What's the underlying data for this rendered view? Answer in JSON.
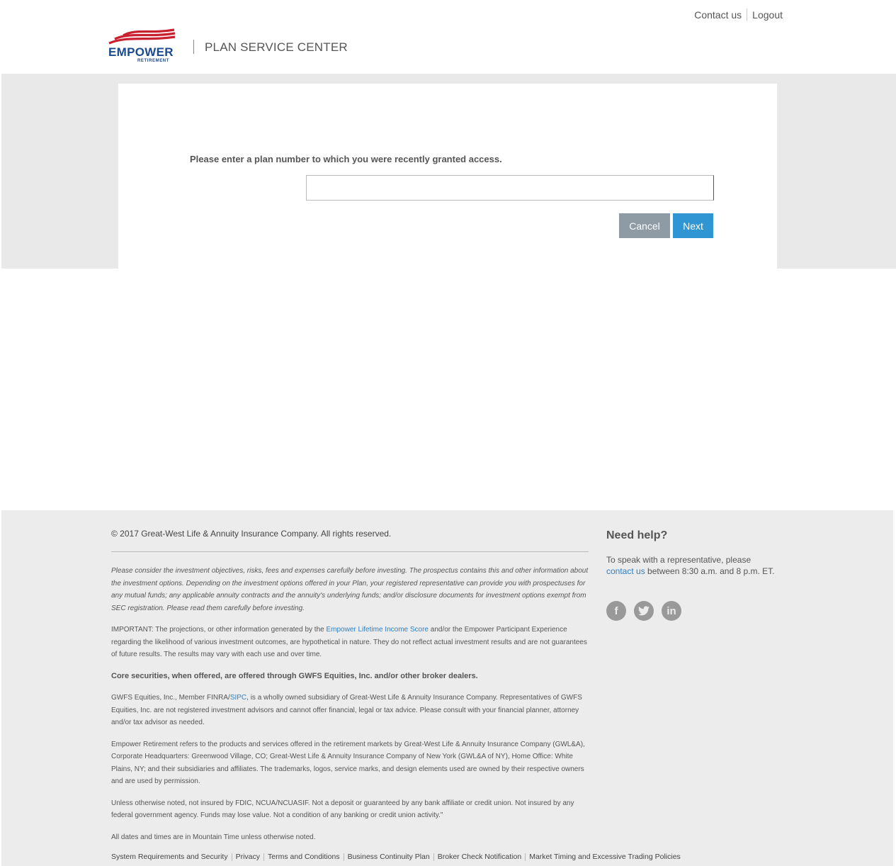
{
  "header": {
    "contact_label": "Contact us",
    "logout_label": "Logout",
    "logo_text": "EMPOWER",
    "logo_subtext": "RETIREMENT",
    "app_title": "PLAN SERVICE CENTER"
  },
  "form": {
    "prompt": "Please enter a plan number to which you were recently granted access.",
    "plan_number_value": "",
    "cancel_label": "Cancel",
    "next_label": "Next"
  },
  "footer": {
    "copyright": "© 2017 Great-West Life & Annuity Insurance Company. All rights reserved.",
    "prospectus": "Please consider the investment objectives, risks, fees and expenses carefully before investing. The prospectus contains this and other information about the investment options. Depending on the investment options offered in your Plan, your registered representative can provide you with prospectuses for any mutual funds; any applicable annuity contracts and the annuity's underlying funds; and/or disclosure documents for investment options exempt from SEC registration. Please read them carefully before investing.",
    "important_pre": "IMPORTANT: The projections, or other information generated by the ",
    "important_link": "Empower Lifetime Income Score",
    "important_post": " and/or the Empower Participant Experience regarding the likelihood of various investment outcomes, are hypothetical in nature. They do not reflect actual investment results and are not guarantees of future results. The results may vary with each use and over time.",
    "core_securities": "Core securities, when offered, are offered through GWFS Equities, Inc. and/or other broker dealers.",
    "gwfs_pre": "GWFS Equities, Inc., Member FINRA/",
    "gwfs_link": "SIPC",
    "gwfs_post": ", is a wholly owned subsidiary of Great-West Life & Annuity Insurance Company. Representatives of GWFS Equities, Inc. are not registered investment advisors and cannot offer financial, legal or tax advice. Please consult with your financial planner, attorney and/or tax advisor as needed.",
    "empower_refers": "Empower Retirement refers to the products and services offered in the retirement markets by Great-West Life & Annuity Insurance Company (GWL&A), Corporate Headquarters: Greenwood Village, CO; Great-West Life & Annuity Insurance Company of New York (GWL&A of NY), Home Office: White Plains, NY; and their subsidiaries and affiliates. The trademarks, logos, service marks, and design elements used are owned by their respective owners and are used by permission.",
    "not_insured": "Unless otherwise noted, not insured by FDIC, NCUA/NCUASIF. Not a deposit or guaranteed by any bank affiliate or credit union. Not insured by any federal government agency. Funds may lose value. Not a condition of any banking or credit union activity.\"",
    "mountain_time": "All dates and times are in Mountain Time unless otherwise noted.",
    "links": [
      "System Requirements and Security",
      "Privacy",
      "Terms and Conditions",
      "Business Continuity Plan",
      "Broker Check Notification",
      "Market Timing and Excessive Trading Policies"
    ],
    "help_title": "Need help?",
    "help_pre": "To speak with a representative, please ",
    "help_link": "contact us",
    "help_post": "  between 8:30 a.m. and 8 p.m. ET.",
    "social": {
      "facebook": "f",
      "twitter": "t",
      "linkedin": "in"
    }
  }
}
